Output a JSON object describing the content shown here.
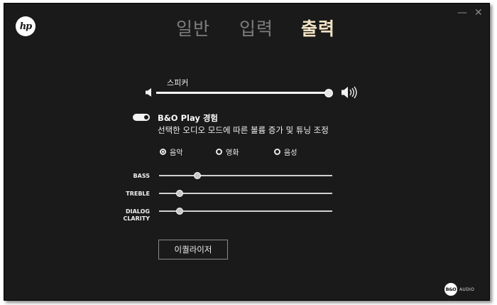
{
  "app": {
    "logo_text": "hp"
  },
  "window_controls": {
    "minimize": "—",
    "close": "✕"
  },
  "tabs": [
    {
      "label": "일반",
      "active": false
    },
    {
      "label": "입력",
      "active": false
    },
    {
      "label": "출력",
      "active": true
    }
  ],
  "speaker": {
    "label": "스피커",
    "volume_fraction": 1.0
  },
  "bo_play": {
    "enabled": true,
    "title": "B&O Play 경험",
    "description": "선택한 오디오 모드에 따른 볼륨 증가 및 튜닝 조정"
  },
  "modes": [
    {
      "label": "음악",
      "selected": true
    },
    {
      "label": "영화",
      "selected": false
    },
    {
      "label": "음성",
      "selected": false
    }
  ],
  "equalizer_sliders": [
    {
      "label": "BASS",
      "value_fraction": 0.22
    },
    {
      "label": "TREBLE",
      "value_fraction": 0.12
    },
    {
      "label_line1": "DIALOG",
      "label_line2": "CLARITY",
      "value_fraction": 0.12
    }
  ],
  "equalizer_button": {
    "label": "이퀄라이저"
  },
  "footer": {
    "bo_logo": "B&O",
    "audio_label": "AUDIO"
  },
  "colors": {
    "background": "#1a1a1a",
    "active_tab": "#f0e2c4",
    "inactive_tab": "#7d7d7d"
  }
}
